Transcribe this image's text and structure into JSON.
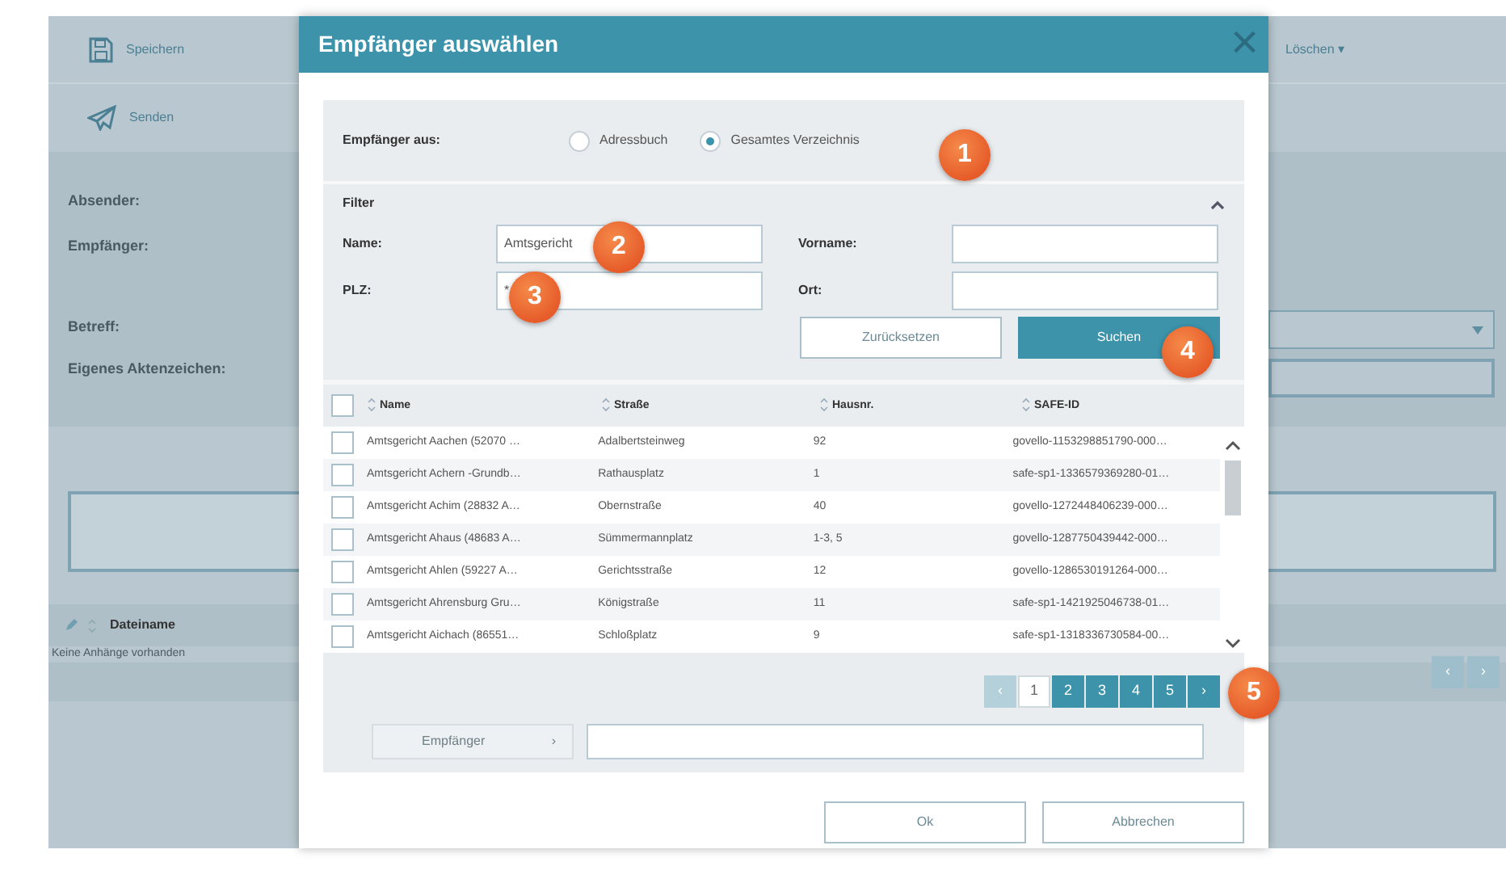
{
  "app": {
    "toolbar": [
      {
        "label": "Speichern"
      },
      {
        "label": "Senden"
      }
    ],
    "toolbar_right": {
      "label": "Löschen",
      "caret": "▾"
    },
    "form_labels": [
      "Absender:",
      "Empfänger:",
      "Betreff:",
      "Eigenes Aktenzeichen:"
    ],
    "attachments": {
      "column": "Dateiname",
      "empty": "Keine Anhänge vorhanden",
      "pager": [
        "‹",
        "›"
      ]
    }
  },
  "dialog": {
    "title": "Empfänger auswählen",
    "close": "×",
    "source": {
      "label": "Empfänger aus:",
      "options": [
        {
          "label": "Adressbuch",
          "selected": false
        },
        {
          "label": "Gesamtes Verzeichnis",
          "selected": true
        }
      ]
    },
    "filter": {
      "title": "Filter",
      "expanded": true,
      "fields": [
        {
          "label": "Name:",
          "value": "Amtsgericht"
        },
        {
          "label": "Vorname:"
        },
        {
          "label": "PLZ:",
          "value": "*"
        },
        {
          "label": "Ort:"
        }
      ],
      "buttons": [
        {
          "label": "Zurücksetzen",
          "kind": "secondary"
        },
        {
          "label": "Suchen",
          "kind": "primary"
        }
      ]
    },
    "table": {
      "select_all_checked": false,
      "columns": [
        "Name",
        "Straße",
        "Hausnr.",
        "SAFE-ID"
      ],
      "rows": [
        {
          "checked": false,
          "cells": [
            "Amtsgericht Aachen (52070 …",
            "Adalbertsteinweg",
            "92",
            "govello-1153298851790-000…"
          ]
        },
        {
          "checked": false,
          "cells": [
            "Amtsgericht Achern -Grundb…",
            "Rathausplatz",
            "1",
            "safe-sp1-1336579369280-01…"
          ]
        },
        {
          "checked": false,
          "cells": [
            "Amtsgericht Achim (28832 A…",
            "Obernstraße",
            "40",
            "govello-1272448406239-000…"
          ]
        },
        {
          "checked": false,
          "cells": [
            "Amtsgericht Ahaus (48683 A…",
            "Sümmermannplatz",
            "1-3, 5",
            "govello-1287750439442-000…"
          ]
        },
        {
          "checked": false,
          "cells": [
            "Amtsgericht Ahlen (59227 A…",
            "Gerichtsstraße",
            "12",
            "govello-1286530191264-000…"
          ]
        },
        {
          "checked": false,
          "cells": [
            "Amtsgericht Ahrensburg Gru…",
            "Königstraße",
            "11",
            "safe-sp1-1421925046738-01…"
          ]
        },
        {
          "checked": false,
          "cells": [
            "Amtsgericht Aichach (86551…",
            "Schloßplatz",
            "9",
            "safe-sp1-1318336730584-00…"
          ]
        }
      ]
    },
    "pagination": [
      {
        "label": "‹",
        "selected": false,
        "disabled": true
      },
      {
        "label": "1",
        "selected": true,
        "disabled": false
      },
      {
        "label": "2",
        "selected": false,
        "disabled": false
      },
      {
        "label": "3",
        "selected": false,
        "disabled": false
      },
      {
        "label": "4",
        "selected": false,
        "disabled": false
      },
      {
        "label": "5",
        "selected": false,
        "disabled": false
      },
      {
        "label": "›",
        "selected": false,
        "disabled": false
      }
    ],
    "recipient_button": {
      "label": "Empfänger",
      "caret": "›",
      "disabled": true
    },
    "footer": [
      "Ok",
      "Abbrechen"
    ]
  },
  "callouts": [
    "1",
    "2",
    "3",
    "4",
    "5"
  ]
}
